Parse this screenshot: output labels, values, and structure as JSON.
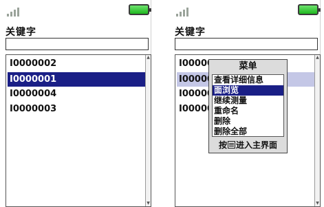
{
  "screens": [
    {
      "field_label": "关键字",
      "keyword_value": "",
      "items": [
        {
          "label": "I0000002",
          "state": "normal"
        },
        {
          "label": "I0000001",
          "state": "selected"
        },
        {
          "label": "I0000004",
          "state": "normal"
        },
        {
          "label": "I0000003",
          "state": "normal"
        }
      ]
    },
    {
      "field_label": "关键字",
      "keyword_value": "",
      "items": [
        {
          "label": "I000000",
          "state": "normal"
        },
        {
          "label": "I00000",
          "state": "faded"
        },
        {
          "label": "I00000",
          "state": "normal"
        },
        {
          "label": "I00000",
          "state": "normal"
        }
      ],
      "menu": {
        "title": "菜单",
        "items": [
          "查看详细信息",
          "面浏览",
          "继续测量",
          "重命名",
          "删除",
          "删除全部"
        ],
        "selected_index": 1,
        "footer_prefix": "按",
        "footer_icon": "menu-key-icon",
        "footer_suffix": "进入主界面"
      }
    }
  ],
  "colors": {
    "selection": "#1a1f86",
    "battery": "#1fb81f"
  }
}
